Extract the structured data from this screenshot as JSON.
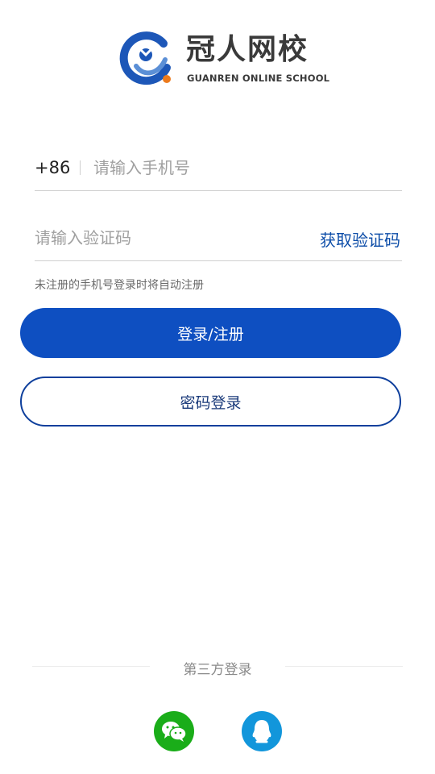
{
  "brand": {
    "title": "冠人网校",
    "subtitle": "GUANREN ONLINE SCHOOL",
    "colors": {
      "blue": "#1d57b8",
      "orange": "#ec7a1c"
    }
  },
  "form": {
    "country_code": "+86",
    "phone_placeholder": "请输入手机号",
    "code_placeholder": "请输入验证码",
    "get_code_label": "获取验证码",
    "hint": "未注册的手机号登录时将自动注册"
  },
  "buttons": {
    "login_register": "登录/注册",
    "password_login": "密码登录"
  },
  "third_party": {
    "label": "第三方登录",
    "items": [
      {
        "icon": "wechat-icon",
        "color": "#1aad19"
      },
      {
        "icon": "qq-icon",
        "color": "#1296db"
      }
    ]
  },
  "theme": {
    "primary": "#0e4fc1",
    "link": "#0d4da8"
  }
}
